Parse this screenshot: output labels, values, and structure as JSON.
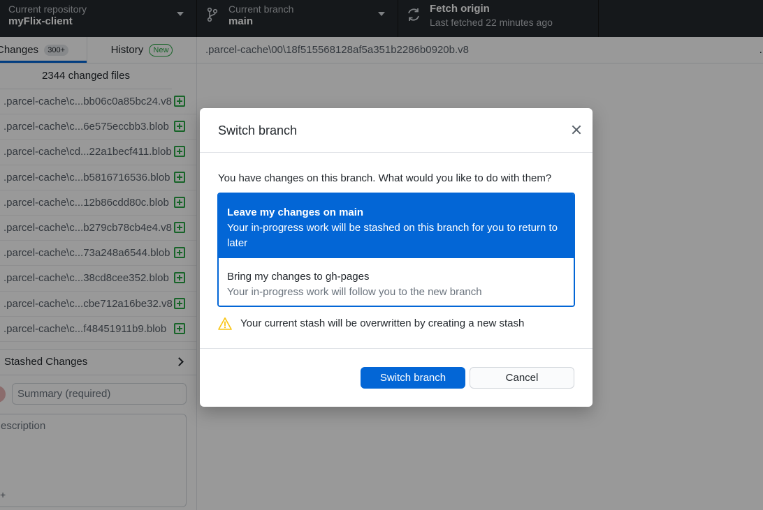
{
  "toolbar": {
    "repository": {
      "label": "Current repository",
      "value": "myFlix-client"
    },
    "branch": {
      "label": "Current branch",
      "value": "main"
    },
    "fetch": {
      "label": "Fetch origin",
      "sub": "Last fetched 22 minutes ago"
    }
  },
  "sidebar": {
    "tabs": {
      "changes": {
        "label": "Changes",
        "badge": "300+"
      },
      "history": {
        "label": "History",
        "badge": "New"
      }
    },
    "changed_count": "2344 changed files",
    "files": [
      ".parcel-cache\\c...bb06c0a85bc24.v8",
      ".parcel-cache\\c...6e575eccbb3.blob",
      ".parcel-cache\\cd...22a1becf411.blob",
      ".parcel-cache\\c...b5816716536.blob",
      ".parcel-cache\\c...12b86cdd80c.blob",
      ".parcel-cache\\c...b279cb78cb4e4.v8",
      ".parcel-cache\\c...73a248a6544.blob",
      ".parcel-cache\\c...38cd8cee352.blob",
      ".parcel-cache\\c...cbe712a16be32.v8",
      ".parcel-cache\\c...f48451911b9.blob"
    ],
    "stashed_label": "Stashed Changes",
    "summary_placeholder": "Summary (required)",
    "description_placeholder": "escription",
    "coauthor_glyph": "+"
  },
  "path_bar": {
    "path": ".parcel-cache\\00\\18f515568128af5a351b2286b0920b.v8",
    "more": "…"
  },
  "dialog": {
    "title": "Switch branch",
    "question": "You have changes on this branch. What would you like to do with them?",
    "options": [
      {
        "title": "Leave my changes on main",
        "desc": "Your in-progress work will be stashed on this branch for you to return to later",
        "selected": true
      },
      {
        "title": "Bring my changes to gh-pages",
        "desc": "Your in-progress work will follow you to the new branch",
        "selected": false
      }
    ],
    "warning": "Your current stash will be overwritten by creating a new stash",
    "primary_button": "Switch branch",
    "cancel_button": "Cancel"
  },
  "colors": {
    "accent": "#0366d6",
    "toolbar_bg": "#24292e",
    "add_green": "#28a745",
    "warning": "#f9c513"
  }
}
